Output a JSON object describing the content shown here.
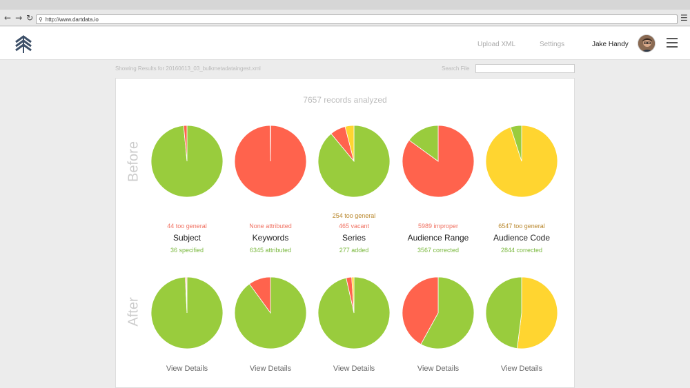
{
  "browser": {
    "url": "http://www.dartdata.io"
  },
  "header": {
    "nav": [
      {
        "label": "Upload XML"
      },
      {
        "label": "Settings"
      }
    ],
    "user_name": "Jake Handy"
  },
  "toolbar": {
    "showing": "Showing Results for 20160613_03_bulkmetadataingest.xml",
    "search_label": "Search File",
    "search_value": ""
  },
  "summary": {
    "records": "7657 records analyzed",
    "before_label": "Before",
    "after_label": "After",
    "view_details": "View Details"
  },
  "colors": {
    "green": "#99cc3d",
    "red": "#ff634d",
    "yellow": "#ffd530",
    "stat_red": "#f07060",
    "stat_green": "#7ab83e",
    "stat_orange": "#b8862a"
  },
  "categories": [
    {
      "title": "Subject",
      "stats_before": [
        {
          "text": "44 too general",
          "tone": "red"
        }
      ],
      "stat_after": "36 specified"
    },
    {
      "title": "Keywords",
      "stats_before": [
        {
          "text": "None attributed",
          "tone": "red"
        }
      ],
      "stat_after": "6345 attributed"
    },
    {
      "title": "Series",
      "stats_before": [
        {
          "text": "254 too general",
          "tone": "orange"
        },
        {
          "text": "465 vacant",
          "tone": "red"
        }
      ],
      "stat_after": "277 added"
    },
    {
      "title": "Audience Range",
      "stats_before": [
        {
          "text": "5989 improper",
          "tone": "red"
        }
      ],
      "stat_after": "3567 corrected"
    },
    {
      "title": "Audience Code",
      "stats_before": [
        {
          "text": "6547 too general",
          "tone": "orange"
        }
      ],
      "stat_after": "2844 corrected"
    }
  ],
  "chart_data": [
    {
      "type": "pie",
      "row": "Before",
      "category": "Subject",
      "slices": [
        {
          "color": "green",
          "value": 0.985
        },
        {
          "color": "red",
          "value": 0.015
        }
      ]
    },
    {
      "type": "pie",
      "row": "Before",
      "category": "Keywords",
      "slices": [
        {
          "color": "red",
          "value": 0.998
        },
        {
          "color": "green",
          "value": 0.002
        }
      ]
    },
    {
      "type": "pie",
      "row": "Before",
      "category": "Series",
      "slices": [
        {
          "color": "green",
          "value": 0.89
        },
        {
          "color": "red",
          "value": 0.07
        },
        {
          "color": "yellow",
          "value": 0.04
        }
      ]
    },
    {
      "type": "pie",
      "row": "Before",
      "category": "Audience Range",
      "slices": [
        {
          "color": "red",
          "value": 0.85
        },
        {
          "color": "green",
          "value": 0.15
        }
      ]
    },
    {
      "type": "pie",
      "row": "Before",
      "category": "Audience Code",
      "slices": [
        {
          "color": "yellow",
          "value": 0.95
        },
        {
          "color": "green",
          "value": 0.05
        }
      ]
    },
    {
      "type": "pie",
      "row": "After",
      "category": "Subject",
      "slices": [
        {
          "color": "green",
          "value": 0.992
        },
        {
          "color": "red",
          "value": 0.005
        },
        {
          "color": "yellow",
          "value": 0.003
        }
      ]
    },
    {
      "type": "pie",
      "row": "After",
      "category": "Keywords",
      "slices": [
        {
          "color": "green",
          "value": 0.9
        },
        {
          "color": "red",
          "value": 0.1
        }
      ]
    },
    {
      "type": "pie",
      "row": "After",
      "category": "Series",
      "slices": [
        {
          "color": "green",
          "value": 0.965
        },
        {
          "color": "red",
          "value": 0.025
        },
        {
          "color": "yellow",
          "value": 0.01
        }
      ]
    },
    {
      "type": "pie",
      "row": "After",
      "category": "Audience Range",
      "slices": [
        {
          "color": "green",
          "value": 0.58
        },
        {
          "color": "red",
          "value": 0.42
        }
      ]
    },
    {
      "type": "pie",
      "row": "After",
      "category": "Audience Code",
      "slices": [
        {
          "color": "yellow",
          "value": 0.52
        },
        {
          "color": "green",
          "value": 0.48
        }
      ]
    }
  ]
}
